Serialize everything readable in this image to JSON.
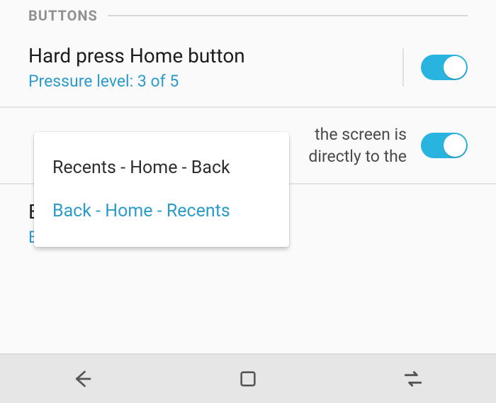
{
  "section_title": "BUTTONS",
  "hard_press": {
    "title": "Hard press Home button",
    "subtitle": "Pressure level: 3 of 5",
    "enabled": true
  },
  "hidden_row": {
    "body_line1": "the screen is",
    "body_line2": "directly to the",
    "enabled": true
  },
  "button_layout": {
    "title": "Button layout",
    "value": "Back - Home - Recents"
  },
  "popup": {
    "options": [
      "Recents - Home - Back",
      "Back - Home - Recents"
    ],
    "selected_index": 1
  },
  "nav": {
    "back": "back-icon",
    "home": "home-icon",
    "recents": "recents-icon"
  }
}
